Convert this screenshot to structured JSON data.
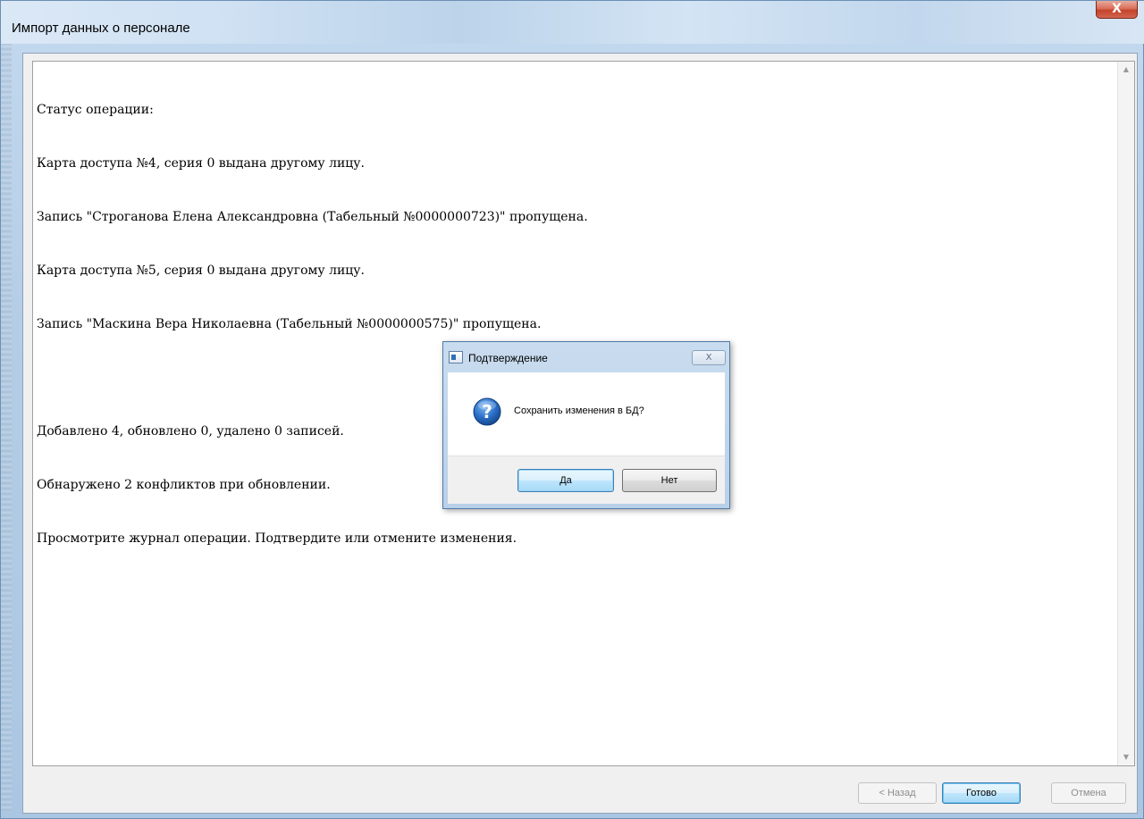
{
  "window": {
    "title": "Импорт данных о персонале",
    "close_glyph": "X"
  },
  "log": {
    "lines": [
      "Статус операции:",
      "Карта доступа №4, серия 0 выдана другому лицу.",
      "Запись \"Строганова Елена Александровна (Табельный №0000000723)\" пропущена.",
      "Карта доступа №5, серия 0 выдана другому лицу.",
      "Запись \"Маскина Вера Николаевна (Табельный №0000000575)\" пропущена.",
      "",
      "Добавлено 4, обновлено 0, удалено 0 записей.",
      "Обнаружено 2 конфликтов при обновлении.",
      "Просмотрите журнал операции. Подтвердите или отмените изменения."
    ]
  },
  "wizard_buttons": {
    "back_label": "< Назад",
    "done_label": "Готово",
    "cancel_label": "Отмена"
  },
  "dialog": {
    "title": "Подтверждение",
    "close_glyph": "X",
    "icon": "question-icon",
    "message": "Сохранить изменения в БД?",
    "yes_label": "Да",
    "no_label": "Нет"
  },
  "colors": {
    "title_bar": "#c3d9ef",
    "close_button": "#c4432b",
    "default_button_border": "#3c7fb1"
  }
}
